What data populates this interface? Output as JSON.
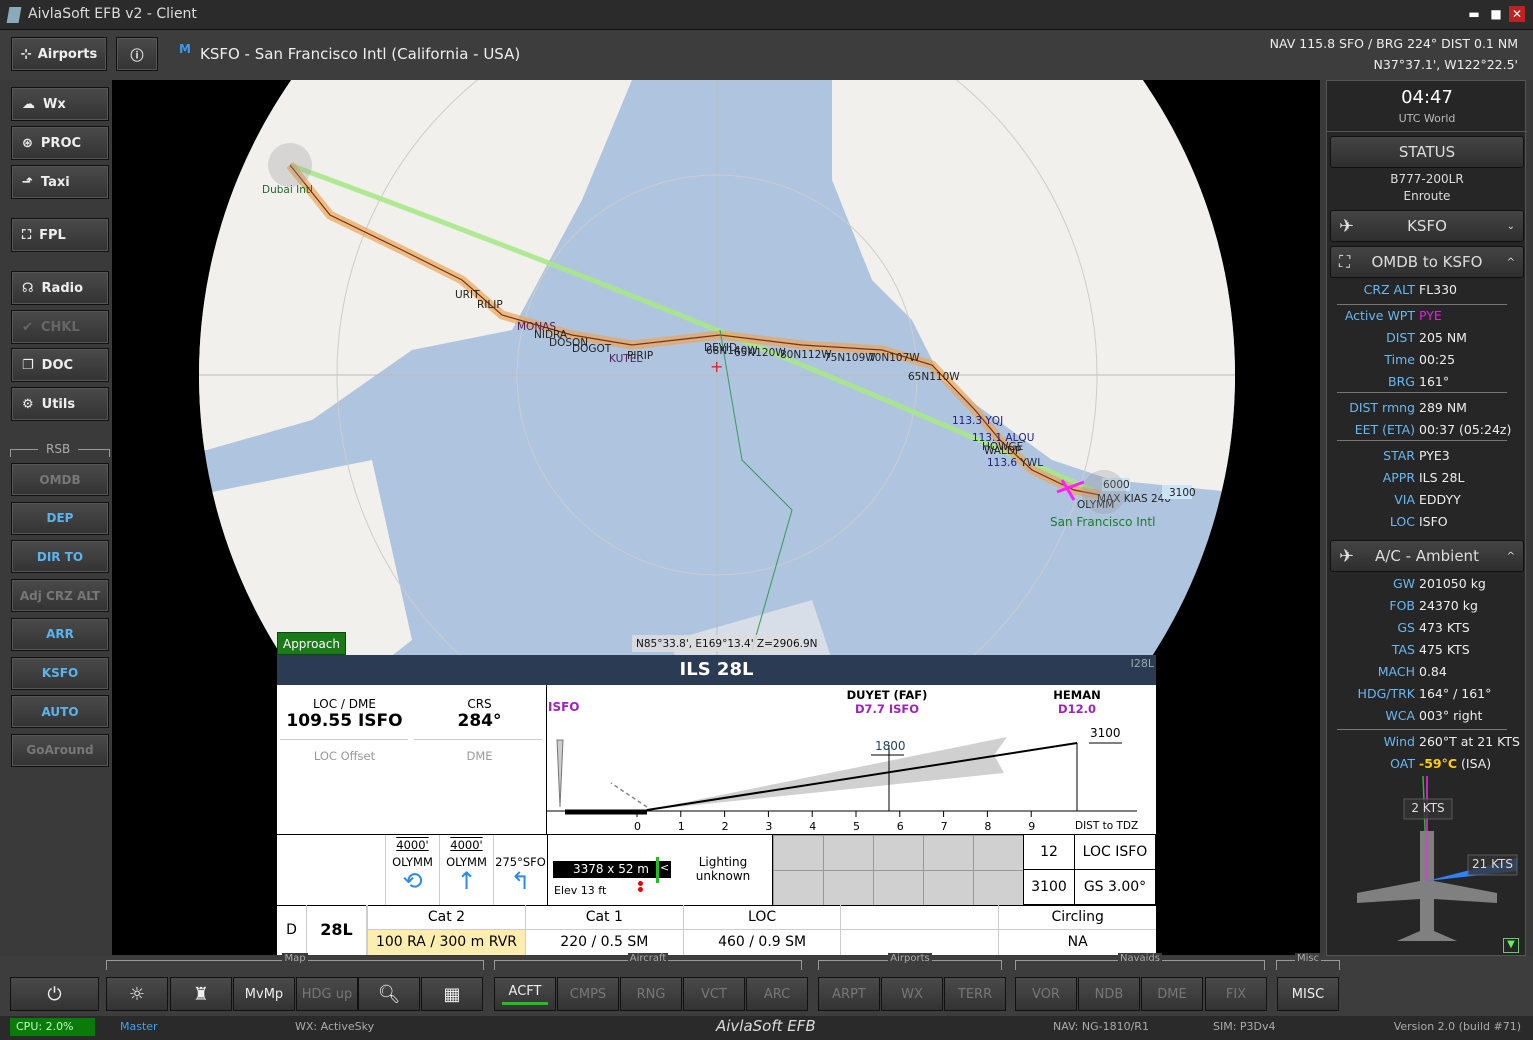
{
  "window": {
    "title": "AivlaSoft EFB v2 - Client",
    "minimize": "▬",
    "maximize": "■",
    "close": "✕"
  },
  "topbar": {
    "airports_label": "Airports",
    "info_label": "ⓘ",
    "badge": "M",
    "airport_title": "KSFO - San Francisco Intl (California - USA)",
    "nav_info": "NAV 115.8 SFO / BRG 224°  DIST 0.1 NM",
    "position": "N37°37.1', W122°22.5'"
  },
  "left_menu": [
    {
      "label": "Wx",
      "icon": "cloud-sun-icon",
      "enabled": true
    },
    {
      "label": "PROC",
      "icon": "procedure-icon",
      "enabled": true
    },
    {
      "label": "Taxi",
      "icon": "taxi-arrow-icon",
      "enabled": true
    },
    {
      "label": "FPL",
      "icon": "map-icon",
      "enabled": true
    },
    {
      "label": "Radio",
      "icon": "headset-icon",
      "enabled": true
    },
    {
      "label": "CHKL",
      "icon": "checklist-icon",
      "enabled": false
    },
    {
      "label": "DOC",
      "icon": "document-icon",
      "enabled": true
    },
    {
      "label": "Utils",
      "icon": "tools-icon",
      "enabled": true
    }
  ],
  "rsb": {
    "title": "RSB",
    "buttons": [
      {
        "label": "OMDB",
        "enabled": false
      },
      {
        "label": "DEP",
        "enabled": true
      },
      {
        "label": "DIR TO",
        "enabled": true
      },
      {
        "label": "Adj CRZ ALT",
        "enabled": false
      },
      {
        "label": "ARR",
        "enabled": true
      },
      {
        "label": "KSFO",
        "enabled": true
      },
      {
        "label": "AUTO",
        "enabled": true
      },
      {
        "label": "GoAround",
        "enabled": false
      }
    ]
  },
  "map": {
    "labels": {
      "origin": "Dubai Intl",
      "destination": "San Francisco Intl",
      "wpts": [
        "URIT",
        "RILIP",
        "MONAS",
        "NIDRA",
        "DOSON",
        "DOGOT",
        "KUTEL",
        "PIRIP",
        "DEVID",
        "68N140W",
        "65N120W",
        "80N112W",
        "75N109W",
        "70N107W",
        "65N110W",
        "113.3 YQJ",
        "113.1 ALQU",
        "HOWGE",
        "WALDP",
        "113.6 YWL",
        "OLYMM",
        "MAX KIAS 240"
      ],
      "alt1": "6000",
      "alt2": "3100"
    },
    "coord_readout": "N85°33.8', E169°13.4' Z=2906.9N",
    "mode_badge": "Approach",
    "colors": {
      "ocean": "#aec4df",
      "land": "#f2f0ec",
      "route": "#e8a65a",
      "direct": "#a8e88a"
    }
  },
  "approach": {
    "title": "ILS 28L",
    "ident": "I28L",
    "loc_dme_label": "LOC / DME",
    "loc_dme": "109.55 ISFO",
    "crs_label": "CRS",
    "crs": "284°",
    "loc_offset": "LOC Offset",
    "dme": "DME",
    "profile": {
      "start_label": "ISFO",
      "faf_name": "DUYET (FAF)",
      "faf_dist": "D7.7 ISFO",
      "iaf_name": "HEMAN",
      "iaf_dist": "D12.0",
      "faf_alt": "1800",
      "iaf_alt": "3100",
      "axis_ticks": [
        "0",
        "1",
        "2",
        "3",
        "4",
        "5",
        "6",
        "7",
        "8",
        "9"
      ],
      "axis_label": "DIST to TDZ"
    },
    "missed": [
      {
        "alt": "4000'",
        "fix": "OLYMM",
        "icon": "hold-icon"
      },
      {
        "alt": "4000'",
        "fix": "OLYMM",
        "icon": "arrow-up-icon"
      },
      {
        "alt": "",
        "fix": "275°SFO",
        "icon": "turn-left-icon"
      }
    ],
    "runway": {
      "dims": "3378 x 52 m",
      "arrow": "<",
      "elev": "Elev 13 ft",
      "lighting": "Lighting unknown"
    },
    "info": {
      "a": "12",
      "b": "LOC ISFO",
      "c": "3100",
      "d": "GS  3.00°"
    },
    "minima": {
      "cat": "D",
      "runway": "28L",
      "headers": [
        "Cat 2",
        "Cat 1",
        "LOC",
        "",
        "Circling"
      ],
      "values": [
        "100 RA / 300 m RVR",
        "220 / 0.5 SM",
        "460 / 0.9 SM",
        "",
        "NA"
      ]
    }
  },
  "right": {
    "time": "04:47",
    "time_label": "UTC World",
    "status_btn": "STATUS",
    "aircraft": "B777-200LR",
    "phase": "Enroute",
    "airport_btn": "KSFO",
    "route_btn": "OMDB to KSFO",
    "route": [
      {
        "k": "CRZ ALT",
        "v": "FL330"
      },
      {
        "k": "Active WPT",
        "v": "PYE"
      },
      {
        "k": "DIST",
        "v": "205 NM"
      },
      {
        "k": "Time",
        "v": "00:25"
      },
      {
        "k": "BRG",
        "v": "161°"
      },
      {
        "k": "DIST rmng",
        "v": "289 NM"
      },
      {
        "k": "EET (ETA)",
        "v": "00:37 (05:24z)"
      },
      {
        "k": "STAR",
        "v": "PYE3"
      },
      {
        "k": "APPR",
        "v": "ILS 28L"
      },
      {
        "k": "VIA",
        "v": "EDDYY"
      },
      {
        "k": "LOC",
        "v": "ISFO"
      }
    ],
    "ambient_btn": "A/C - Ambient",
    "ambient": [
      {
        "k": "GW",
        "v": "201050 kg"
      },
      {
        "k": "FOB",
        "v": "24370 kg"
      },
      {
        "k": "GS",
        "v": "473 KTS"
      },
      {
        "k": "TAS",
        "v": "475 KTS"
      },
      {
        "k": "MACH",
        "v": "0.84"
      },
      {
        "k": "HDG/TRK",
        "v": "164° / 161°"
      },
      {
        "k": "WCA",
        "v": "003° right"
      },
      {
        "k": "Wind",
        "v": "260°T at 21 KTS"
      }
    ],
    "oat_label": "OAT",
    "oat_value": "-59°C",
    "oat_suffix": "(ISA)",
    "headwind": "2 KTS",
    "crosswind": "21 KTS",
    "active_wpt_color": "#e020e0",
    "oat_color": "#ffd000"
  },
  "bottom": {
    "groups": [
      "Map",
      "Aircraft",
      "Airports",
      "Navaids",
      "Misc"
    ],
    "buttons": [
      {
        "label": "",
        "icon": "power-icon",
        "enabled": true
      },
      {
        "label": "",
        "icon": "brightness-icon",
        "enabled": true
      },
      {
        "label": "",
        "icon": "tower-icon",
        "enabled": true
      },
      {
        "label": "MvMp",
        "enabled": true
      },
      {
        "label": "HDG up",
        "enabled": false
      },
      {
        "label": "",
        "icon": "search-icon",
        "enabled": true
      },
      {
        "label": "",
        "icon": "map-layers-icon",
        "enabled": true
      },
      {
        "label": "ACFT",
        "enabled": true,
        "active": true
      },
      {
        "label": "CMPS",
        "enabled": false
      },
      {
        "label": "RNG",
        "enabled": false
      },
      {
        "label": "VCT",
        "enabled": false
      },
      {
        "label": "ARC",
        "enabled": false
      },
      {
        "label": "ARPT",
        "enabled": false
      },
      {
        "label": "WX",
        "enabled": false
      },
      {
        "label": "TERR",
        "enabled": false
      },
      {
        "label": "VOR",
        "enabled": false
      },
      {
        "label": "NDB",
        "enabled": false
      },
      {
        "label": "DME",
        "enabled": false
      },
      {
        "label": "FIX",
        "enabled": false
      },
      {
        "label": "MISC",
        "enabled": true
      }
    ]
  },
  "status": {
    "cpu": "CPU: 2.0%",
    "role": "Master",
    "wx": "WX: ActiveSky",
    "brand": "AivlaSoft EFB",
    "nav": "NAV: NG-1810/R1",
    "sim": "SIM: P3Dv4",
    "version": "Version 2.0 (build #71)"
  }
}
